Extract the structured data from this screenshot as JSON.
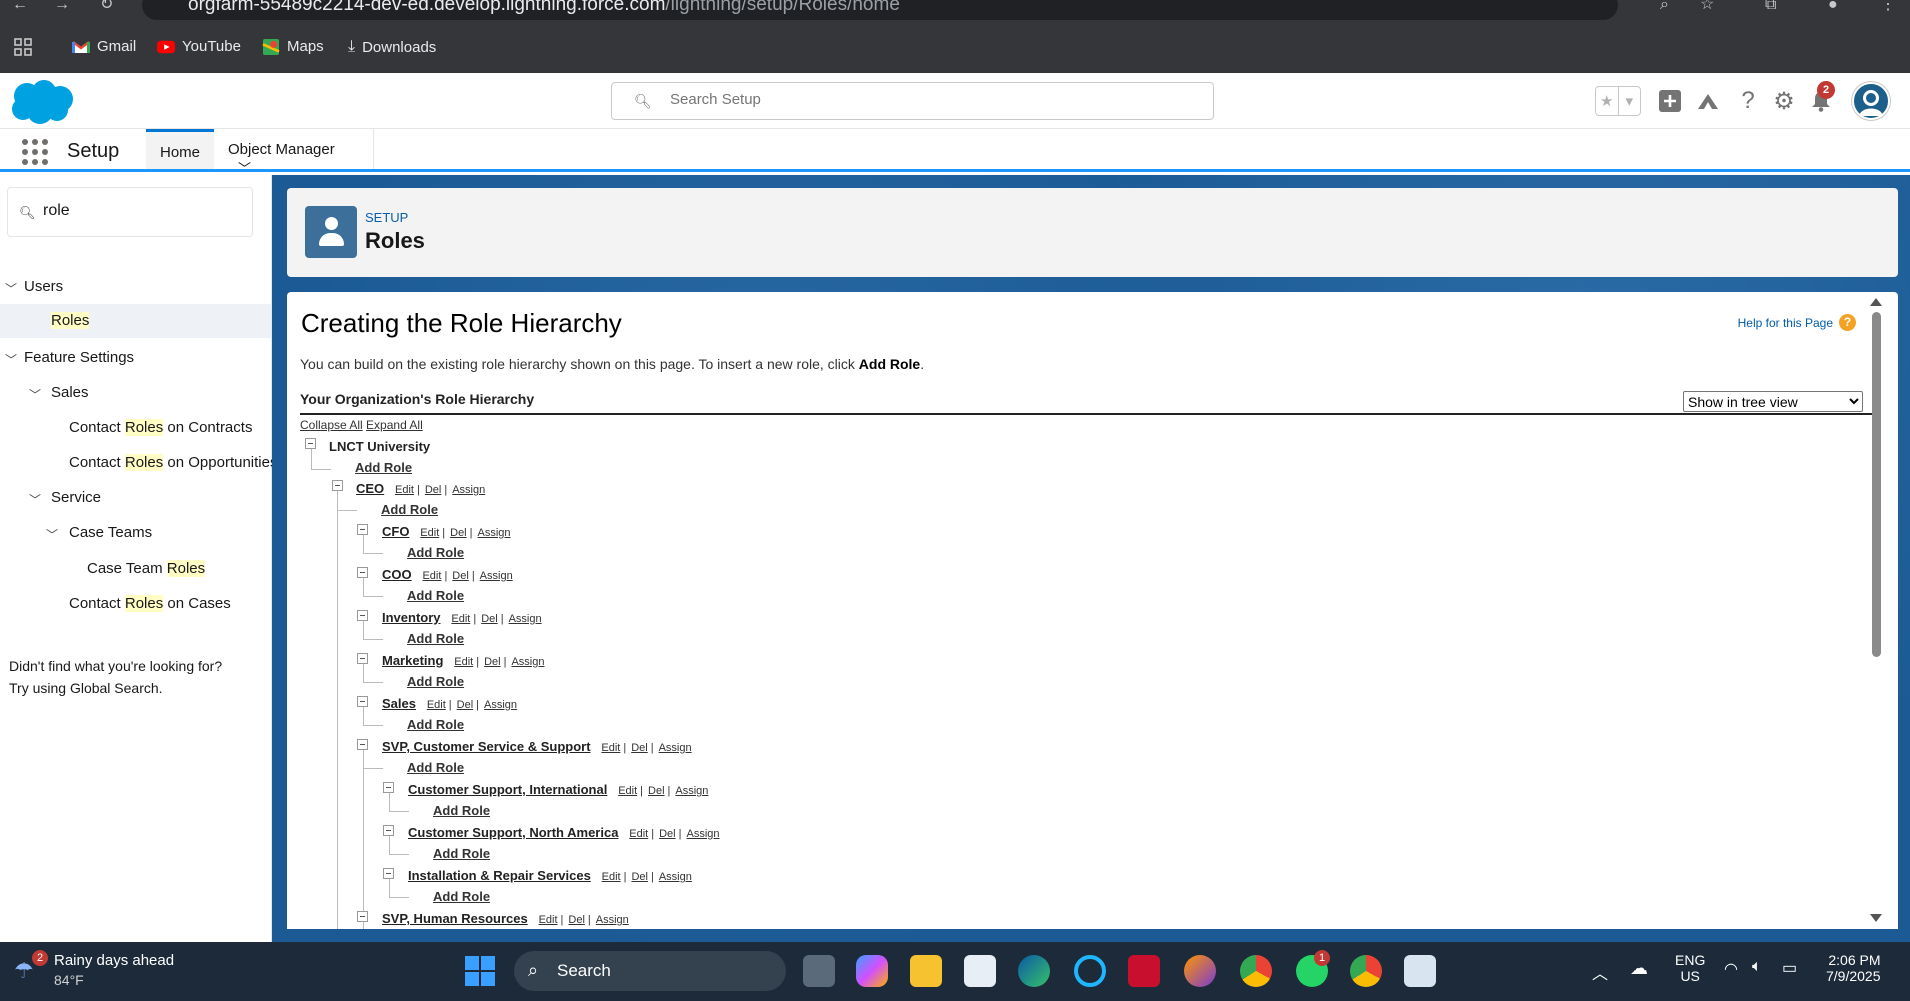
{
  "browser": {
    "url_host": "orgfarm-55489c2214-dev-ed.develop.lightning.force.com",
    "url_path": "/lightning/setup/Roles/home",
    "bookmarks": [
      "Gmail",
      "YouTube",
      "Maps",
      "Downloads"
    ]
  },
  "header": {
    "search_placeholder": "Search Setup",
    "notification_count": "2"
  },
  "context_nav": {
    "app_name": "Setup",
    "tabs": [
      "Home",
      "Object Manager"
    ]
  },
  "sidebar": {
    "quickfind_value": "role",
    "items": {
      "users": "Users",
      "roles": "Roles",
      "feature_settings": "Feature Settings",
      "sales": "Sales",
      "contracts_pre": "Contact ",
      "contracts_hl": "Roles",
      "contracts_post": " on Contracts",
      "opps_pre": "Contact ",
      "opps_hl": "Roles",
      "opps_post": " on Opportunities",
      "service": "Service",
      "case_teams": "Case Teams",
      "ctr_pre": "Case Team ",
      "ctr_hl": "Roles",
      "cases_pre": "Contact ",
      "cases_hl": "Roles",
      "cases_post": " on Cases"
    },
    "not_found_line1": "Didn't find what you're looking for?",
    "not_found_line2": "Try using Global Search."
  },
  "page_header": {
    "eyebrow": "SETUP",
    "title": "Roles"
  },
  "content": {
    "title": "Creating the Role Hierarchy",
    "help": "Help for this Page",
    "intro_pre": "You can build on the existing role hierarchy shown on this page. To insert a new role, click ",
    "intro_bold": "Add Role",
    "intro_post": ".",
    "hierarchy_title": "Your Organization's Role Hierarchy",
    "view_option": "Show in tree view",
    "collapse_all": "Collapse All",
    "expand_all": "Expand All",
    "root": "LNCT University",
    "add_role": "Add Role",
    "edit": "Edit",
    "del": "Del",
    "assign": "Assign",
    "roles": {
      "ceo": "CEO",
      "cfo": "CFO",
      "coo": "COO",
      "inventory": "Inventory",
      "marketing": "Marketing",
      "sales": "Sales",
      "svp_css": "SVP, Customer Service & Support",
      "cs_intl": "Customer Support, International",
      "cs_na": "Customer Support, North America",
      "install": "Installation & Repair Services",
      "svp_hr": "SVP, Human Resources"
    }
  },
  "taskbar": {
    "weather_title": "Rainy days ahead",
    "weather_temp": "84°F",
    "weather_badge": "2",
    "search_label": "Search",
    "whatsapp_badge": "1",
    "lang": "ENG",
    "region": "US",
    "time": "2:06 PM",
    "date": "7/9/2025"
  },
  "colors": {
    "brand_blue": "#0176d3",
    "setup_bg": "#1b5a95",
    "highlight": "#fffdc4"
  }
}
